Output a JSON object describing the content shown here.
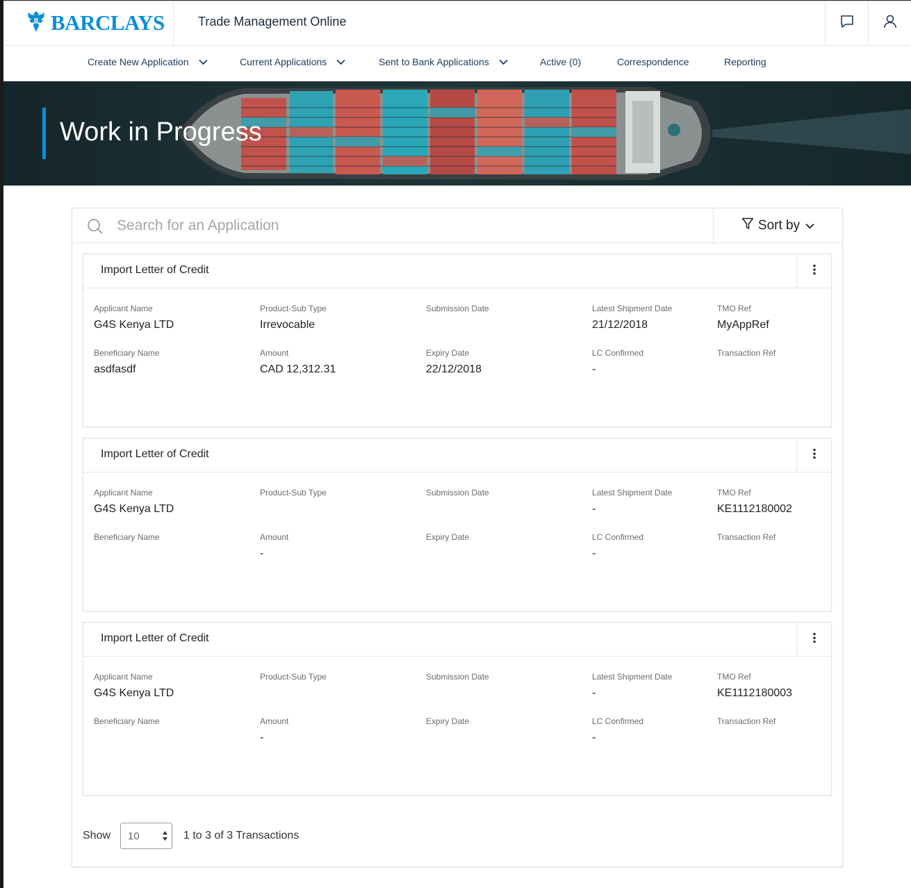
{
  "header": {
    "brand": "BARCLAYS",
    "app_title": "Trade Management Online",
    "icons": [
      "chat-icon",
      "user-icon"
    ],
    "brand_color": "#0a8fd6"
  },
  "nav": {
    "items": [
      {
        "label": "Create New Application",
        "dropdown": true
      },
      {
        "label": "Current Applications",
        "dropdown": true
      },
      {
        "label": "Sent to Bank Applications",
        "dropdown": true
      },
      {
        "label": "Active (0)",
        "dropdown": false
      },
      {
        "label": "Correspondence",
        "dropdown": false
      },
      {
        "label": "Reporting",
        "dropdown": false
      }
    ]
  },
  "banner": {
    "title": "Work in Progress"
  },
  "search": {
    "placeholder": "Search for an Application",
    "value": ""
  },
  "sort": {
    "label": "Sort by"
  },
  "cards": [
    {
      "title": "Import Letter of Credit",
      "fields": {
        "applicant_name": {
          "label": "Applicant Name",
          "value": "G4S Kenya LTD"
        },
        "product_sub_type": {
          "label": "Product-Sub Type",
          "value": "Irrevocable"
        },
        "submission_date": {
          "label": "Submission Date",
          "value": ""
        },
        "latest_shipment_date": {
          "label": "Latest Shipment Date",
          "value": "21/12/2018"
        },
        "tmo_ref": {
          "label": "TMO Ref",
          "value": "MyAppRef"
        },
        "beneficiary_name": {
          "label": "Beneficiary Name",
          "value": "asdfasdf"
        },
        "amount": {
          "label": "Amount",
          "value": "CAD 12,312.31"
        },
        "expiry_date": {
          "label": "Expiry Date",
          "value": "22/12/2018"
        },
        "lc_confirmed": {
          "label": "LC Confirmed",
          "value": "-"
        },
        "transaction_ref": {
          "label": "Transaction Ref",
          "value": ""
        }
      }
    },
    {
      "title": "Import Letter of Credit",
      "fields": {
        "applicant_name": {
          "label": "Applicant Name",
          "value": "G4S Kenya LTD"
        },
        "product_sub_type": {
          "label": "Product-Sub Type",
          "value": ""
        },
        "submission_date": {
          "label": "Submission Date",
          "value": ""
        },
        "latest_shipment_date": {
          "label": "Latest Shipment Date",
          "value": "-"
        },
        "tmo_ref": {
          "label": "TMO Ref",
          "value": "KE1112180002"
        },
        "beneficiary_name": {
          "label": "Beneficiary Name",
          "value": ""
        },
        "amount": {
          "label": "Amount",
          "value": "-"
        },
        "expiry_date": {
          "label": "Expiry Date",
          "value": ""
        },
        "lc_confirmed": {
          "label": "LC Confirmed",
          "value": "-"
        },
        "transaction_ref": {
          "label": "Transaction Ref",
          "value": ""
        }
      }
    },
    {
      "title": "Import Letter of Credit",
      "fields": {
        "applicant_name": {
          "label": "Applicant Name",
          "value": "G4S Kenya LTD"
        },
        "product_sub_type": {
          "label": "Product-Sub Type",
          "value": ""
        },
        "submission_date": {
          "label": "Submission Date",
          "value": ""
        },
        "latest_shipment_date": {
          "label": "Latest Shipment Date",
          "value": "-"
        },
        "tmo_ref": {
          "label": "TMO Ref",
          "value": "KE1112180003"
        },
        "beneficiary_name": {
          "label": "Beneficiary Name",
          "value": ""
        },
        "amount": {
          "label": "Amount",
          "value": "-"
        },
        "expiry_date": {
          "label": "Expiry Date",
          "value": ""
        },
        "lc_confirmed": {
          "label": "LC Confirmed",
          "value": "-"
        },
        "transaction_ref": {
          "label": "Transaction Ref",
          "value": ""
        }
      }
    }
  ],
  "pagination": {
    "show_label": "Show",
    "page_size": "10",
    "summary": "1 to 3 of 3 Transactions"
  }
}
